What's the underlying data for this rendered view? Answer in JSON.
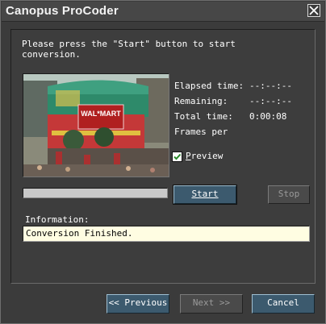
{
  "window": {
    "title": "Canopus ProCoder"
  },
  "instruction": "Please press the \"Start\" button to start\nconversion.",
  "stats": [
    {
      "label": "Elapsed time:",
      "value": "--:--:--"
    },
    {
      "label": "Remaining:",
      "value": "--:--:--"
    },
    {
      "label": "Total time:",
      "value": "0:00:08"
    },
    {
      "label": "Frames per",
      "value": ""
    }
  ],
  "preview_checkbox": {
    "label_first": "P",
    "label_rest": "review",
    "checked": true
  },
  "progress": {
    "fraction": 1.0
  },
  "buttons": {
    "start": "Start",
    "stop": "Stop"
  },
  "information": {
    "label": "Information:",
    "value": "Conversion Finished."
  },
  "nav": {
    "previous": "<< Previous",
    "next": "Next >>",
    "cancel": "Cancel"
  },
  "preview_image": {
    "sign_text": "WAL*MART"
  },
  "colors": {
    "window_bg": "#3b3b3b",
    "accent_button": "#3c5a6e",
    "info_bg": "#fffde2",
    "check": "#2a8a2a"
  }
}
